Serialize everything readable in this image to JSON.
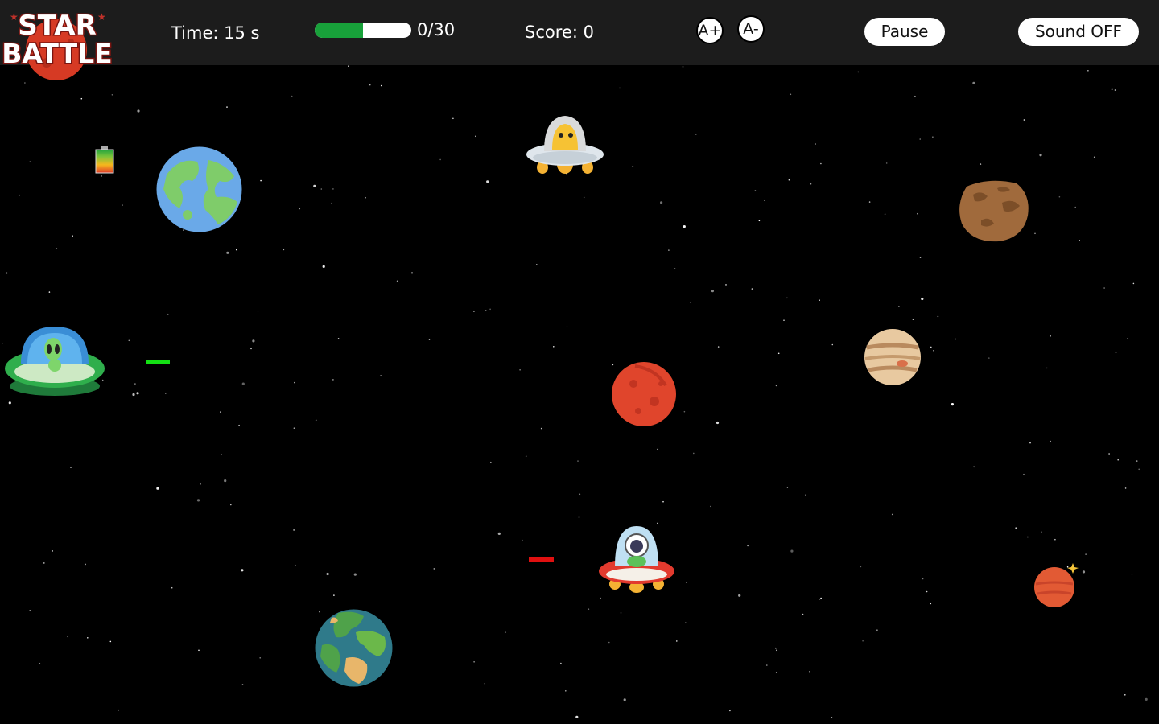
{
  "logo": {
    "line1": "STAR",
    "line2": "BATTLE"
  },
  "hud": {
    "time_label": "Time: 15 s",
    "progress_text": "0/30",
    "progress_fraction": 0.5,
    "score_label": "Score: 0",
    "font_increase": "A+",
    "font_decrease": "A-",
    "pause": "Pause",
    "sound": "Sound OFF"
  },
  "colors": {
    "hud_background": "#1c1c1c",
    "energy_fill": "#18a13a",
    "player_laser": "#14e014",
    "enemy_laser": "#e01010"
  },
  "icons": [
    "battery-icon",
    "earth-planet-icon",
    "robot-ufo-icon",
    "asteroid-icon",
    "green-alien-ufo-icon",
    "jupiter-planet-icon",
    "mars-planet-icon",
    "astronaut-ufo-icon",
    "small-red-planet-icon",
    "earth-globe-icon"
  ]
}
